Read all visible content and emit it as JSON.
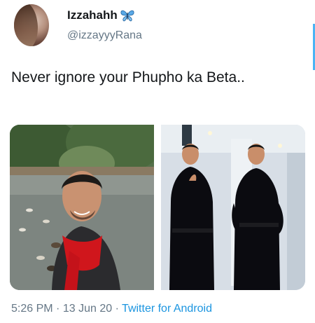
{
  "tweet": {
    "display_name": "Izzahahh",
    "handle": "@izzayyyRana",
    "text": "Never ignore your Phupho ka Beta..",
    "time": "5:26 PM",
    "date": "13 Jun 20",
    "separator": "·",
    "source": "Twitter for Android"
  },
  "icons": {
    "name_emoji": "butterfly-icon"
  },
  "colors": {
    "link": "#1b95e0",
    "secondary_text": "#657786",
    "accent_bar": "#1da1f2"
  }
}
